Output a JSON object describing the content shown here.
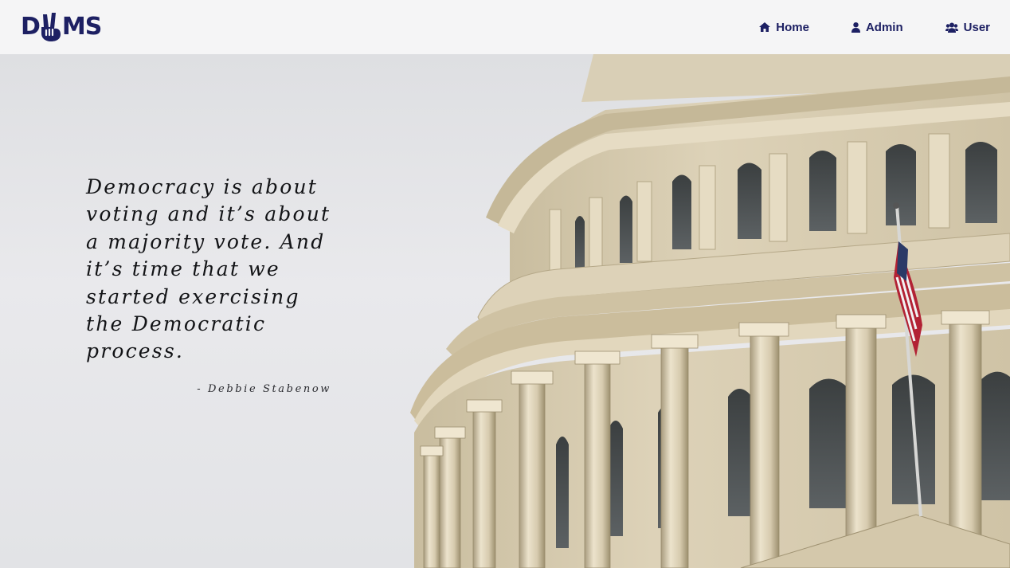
{
  "brand": {
    "logo_text_left": "D",
    "logo_text_right": "MS"
  },
  "nav": {
    "items": [
      {
        "label": "Home",
        "icon": "home-icon"
      },
      {
        "label": "Admin",
        "icon": "user-icon"
      },
      {
        "label": "User",
        "icon": "users-icon"
      }
    ]
  },
  "hero": {
    "quote": "Democracy is about voting and it’s about a majority vote. And it’s time that we started exercising the Democratic process.",
    "author": "- Debbie Stabenow",
    "image": "capitol-dome-photo"
  },
  "colors": {
    "brand": "#1d2063",
    "navbar_bg": "#f5f5f6",
    "sky": "#e5e6e9",
    "stone": "#d8ccb0"
  }
}
